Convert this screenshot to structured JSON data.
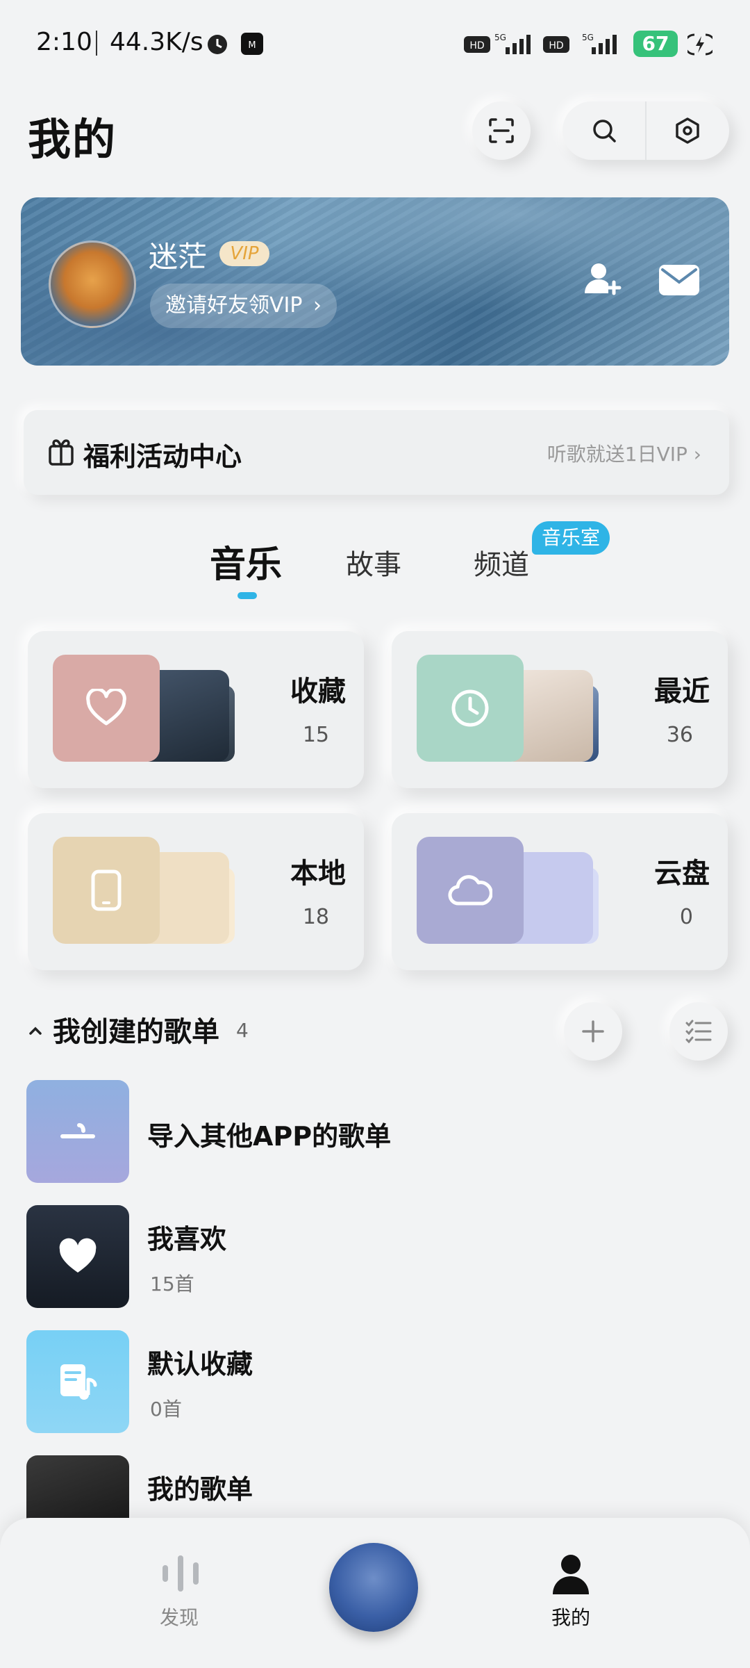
{
  "status_bar": {
    "time": "2:10",
    "speed": "44.3K/s",
    "battery": "67"
  },
  "header": {
    "title": "我的"
  },
  "profile": {
    "username": "迷茫",
    "vip_badge": "VIP",
    "invite_label": "邀请好友领VIP"
  },
  "welfare": {
    "title": "福利活动中心",
    "promo": "听歌就送1日VIP"
  },
  "tabs": {
    "items": [
      "音乐",
      "故事",
      "频道"
    ],
    "badge": "音乐室",
    "active": "音乐"
  },
  "tiles": [
    {
      "name": "收藏",
      "count": "15",
      "icon": "heart-icon"
    },
    {
      "name": "最近",
      "count": "36",
      "icon": "clock-icon"
    },
    {
      "name": "本地",
      "count": "18",
      "icon": "phone-icon"
    },
    {
      "name": "云盘",
      "count": "0",
      "icon": "cloud-icon"
    }
  ],
  "playlists": {
    "section_title": "我创建的歌单",
    "count": "4",
    "items": [
      {
        "title": "导入其他APP的歌单",
        "sub": ""
      },
      {
        "title": "我喜欢",
        "sub": "15首"
      },
      {
        "title": "默认收藏",
        "sub": "0首"
      },
      {
        "title": "我的歌单",
        "sub": ""
      }
    ]
  },
  "bottom_nav": {
    "discover": "发现",
    "mine": "我的"
  },
  "colors": {
    "accent": "#2fb4e6",
    "battery": "#36c27a"
  }
}
